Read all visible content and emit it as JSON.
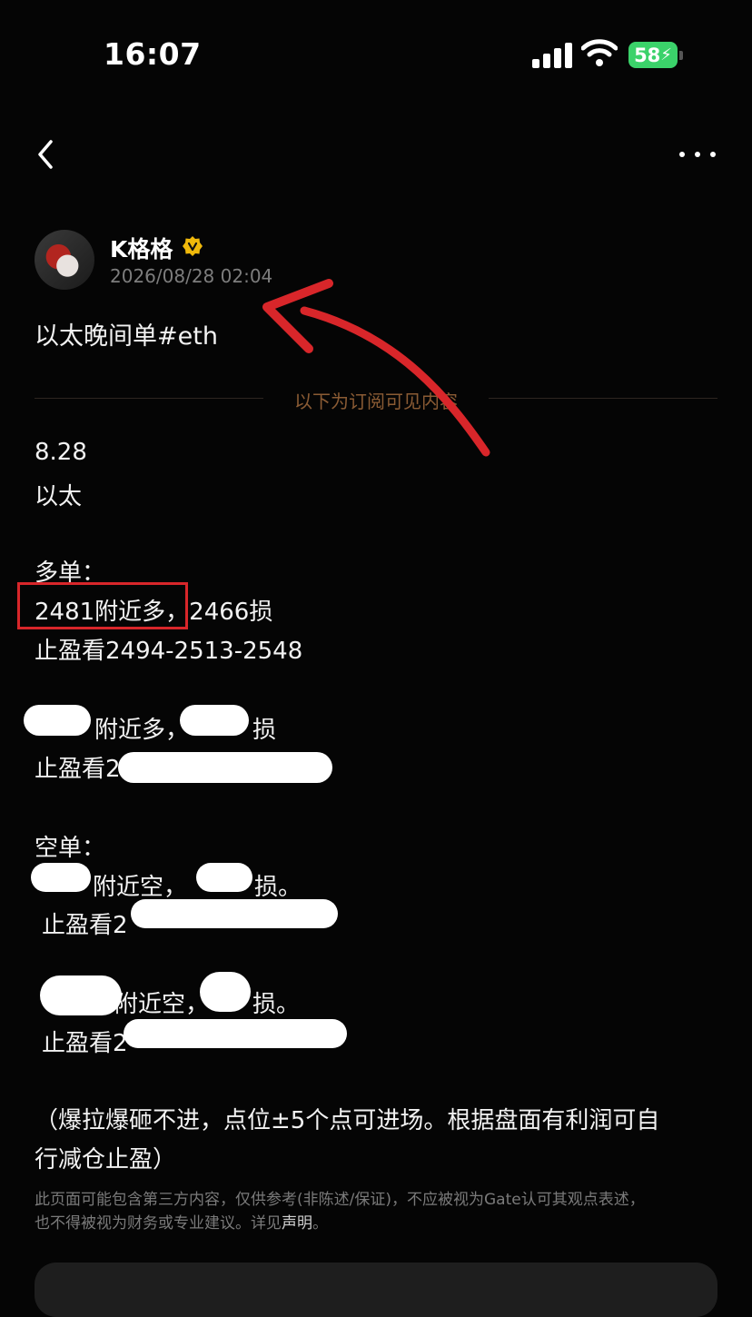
{
  "status_bar": {
    "time": "16:07",
    "battery": "58"
  },
  "author": {
    "name": "K格格",
    "timestamp": "2026/08/28 02:04"
  },
  "post": {
    "title": "以太晚间单#eth",
    "divider": "以下为订阅可见内容",
    "date": "8.28",
    "asset": "以太",
    "long_header": "多单：",
    "long_1_entry": "2481附近多，",
    "long_1_stop": "2466损",
    "long_1_tp": "止盈看2494-2513-2548",
    "long_2_a": "附近多，",
    "long_2_b": "损",
    "long_2_tp": "止盈看2",
    "short_header": "空单：",
    "short_1_a": "附近空，",
    "short_1_b": "损。",
    "short_1_tp": "止盈看2",
    "short_2_a": "附近空，",
    "short_2_b": "损。",
    "short_2_tp": "止盈看2",
    "note_1": "（爆拉爆砸不进，点位±5个点可进场。根据盘面有利润可自",
    "note_2": "行减仓止盈）"
  },
  "disclaimer": {
    "line_1": "此页面可能包含第三方内容，仅供参考(非陈述/保证)，不应被视为Gate认可其观点表述，",
    "line_2": "也不得被视为财务或专业建议。详见",
    "link": "声明",
    "end": "。"
  },
  "colors": {
    "background": "#050505",
    "accent_gold": "#8a5b34",
    "highlight_red": "#d8262a",
    "battery_green": "#3bd26a"
  },
  "icons": [
    "signal-icon",
    "wifi-icon",
    "battery-icon",
    "back-icon",
    "more-icon",
    "verified-icon",
    "arrow-annotation"
  ]
}
